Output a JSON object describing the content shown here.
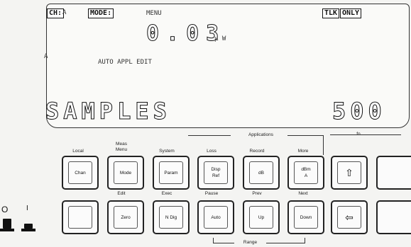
{
  "display": {
    "channel_tag": "CH:",
    "channel_value": "A",
    "mode_tag": "MODE:",
    "menu_label": "MENU",
    "talk_tag": "TLK",
    "only_tag": "ONLY",
    "reading_value": "0.03",
    "reading_unit": "µ W",
    "channel_marker": "A",
    "status_text": "AUTO APPL EDIT",
    "main_label": "SAMPLES",
    "main_value": "500"
  },
  "labels": {
    "local": "Local",
    "meas_menu_1": "Meas",
    "meas_menu_2": "Menu",
    "system": "System",
    "loss": "Loss",
    "record": "Record",
    "more": "More",
    "applications": "Applications",
    "edit": "Edit",
    "exec": "Exec",
    "pause": "Pause",
    "prev": "Prev",
    "next": "Next",
    "range": "Range",
    "fn": "fn"
  },
  "keys_top": [
    {
      "line1": "Chan",
      "line2": ""
    },
    {
      "line1": "Mode",
      "line2": ""
    },
    {
      "line1": "Param",
      "line2": ""
    },
    {
      "line1": "Disp",
      "line2": "Ref"
    },
    {
      "line1": "dB",
      "line2": ""
    },
    {
      "line1": "dBm",
      "line2": "A"
    }
  ],
  "keys_bottom": [
    {
      "line1": ""
    },
    {
      "line1": "Zero"
    },
    {
      "line1": "N Dig"
    },
    {
      "line1": "Auto"
    },
    {
      "line1": "Up"
    },
    {
      "line1": "Down"
    }
  ],
  "icons": {
    "up_arrow": "⇧",
    "left_arrow": "⇦"
  },
  "power": {
    "off_symbol": "O",
    "on_symbol": "I"
  }
}
